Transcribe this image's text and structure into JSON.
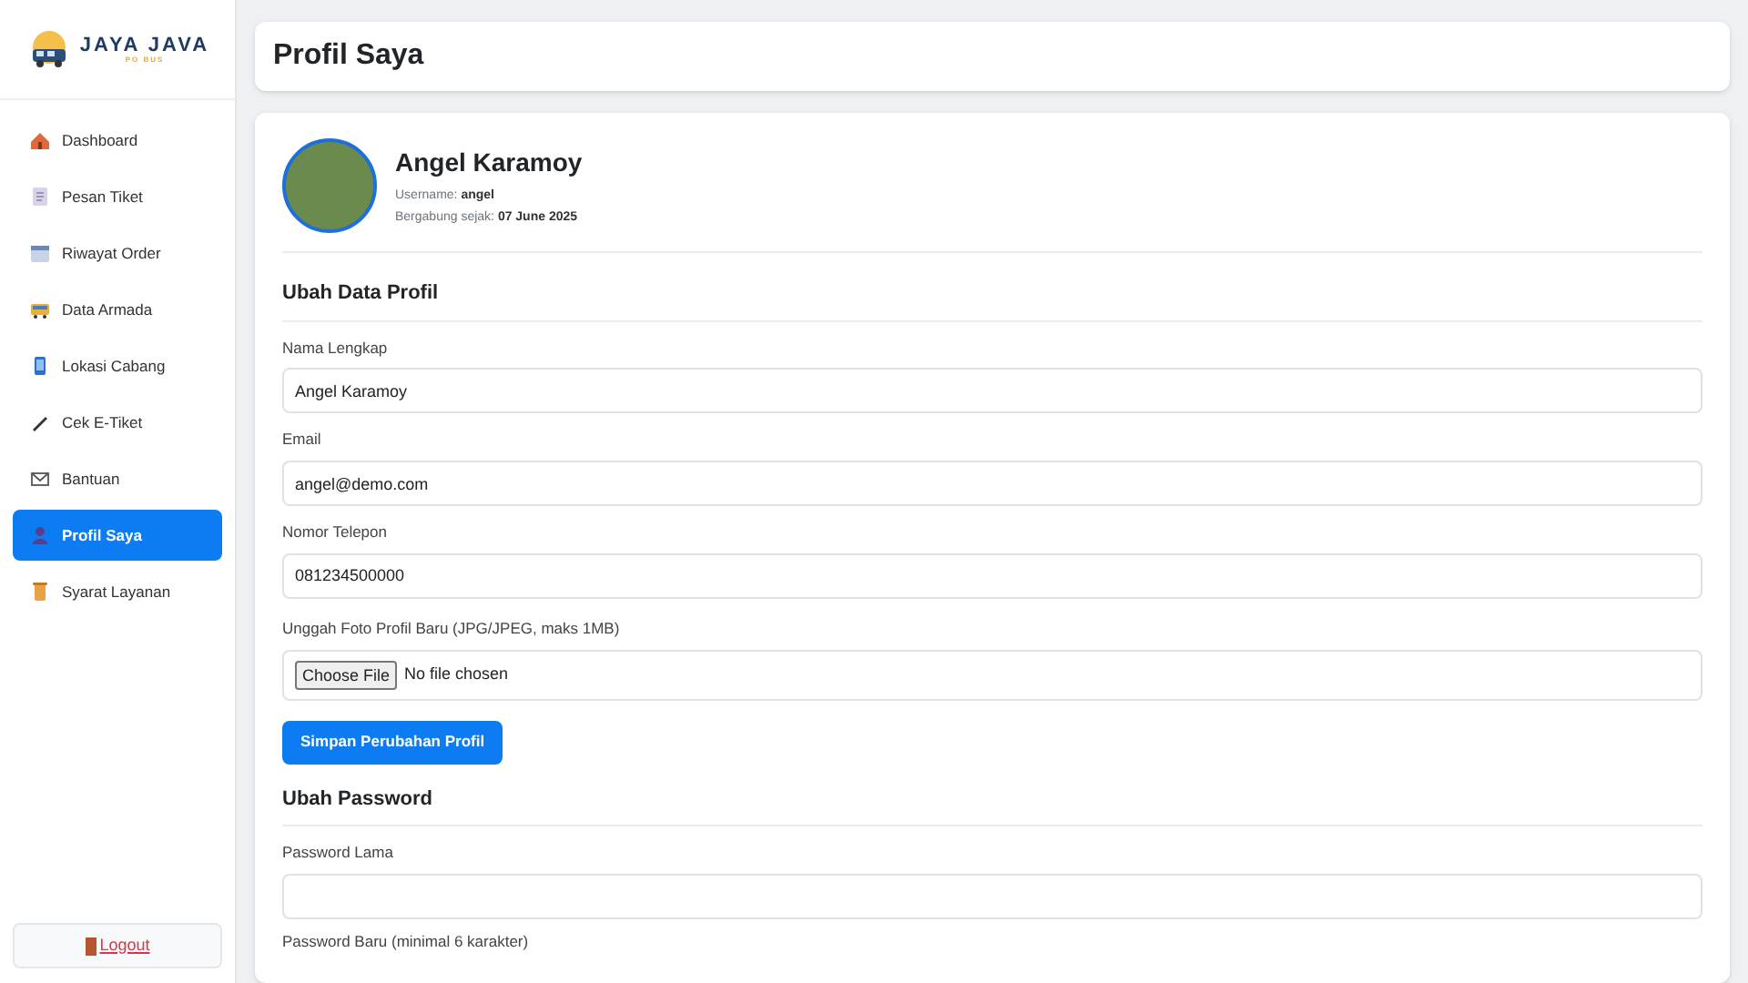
{
  "logo": {
    "title": "JAYA JAVA",
    "subtitle": "PO BUS"
  },
  "sidebar": {
    "items": [
      {
        "label": "Dashboard",
        "selected": false
      },
      {
        "label": "Pesan Tiket",
        "selected": false
      },
      {
        "label": "Riwayat Order",
        "selected": false
      },
      {
        "label": "Data Armada",
        "selected": false
      },
      {
        "label": "Lokasi Cabang",
        "selected": false
      },
      {
        "label": "Cek E-Tiket",
        "selected": false
      },
      {
        "label": "Bantuan",
        "selected": false
      },
      {
        "label": "Profil Saya",
        "selected": true
      },
      {
        "label": "Syarat Layanan",
        "selected": false
      }
    ],
    "logout": "Logout"
  },
  "page_title": "Profil Saya",
  "profile": {
    "name": "Angel Karamoy",
    "username_label": "Username:",
    "username": "angel",
    "joined_label": "Bergabung sejak:",
    "joined": "07 June 2025"
  },
  "profile_form": {
    "title": "Ubah Data Profil",
    "fields": [
      {
        "label": "Nama Lengkap",
        "value": "Angel Karamoy"
      },
      {
        "label": "Email",
        "value": "angel@demo.com"
      },
      {
        "label": "Nomor Telepon",
        "value": "081234500000"
      }
    ],
    "upload": {
      "label": "Unggah Foto Profil Baru (JPG/JPEG, maks 1MB)",
      "button": "Choose File",
      "status": "No file chosen"
    },
    "submit": "Simpan Perubahan Profil"
  },
  "password_form": {
    "title": "Ubah Password",
    "fields": [
      {
        "label": "Password Lama"
      }
    ],
    "next_label": "Password Baru (minimal 6 karakter)"
  }
}
